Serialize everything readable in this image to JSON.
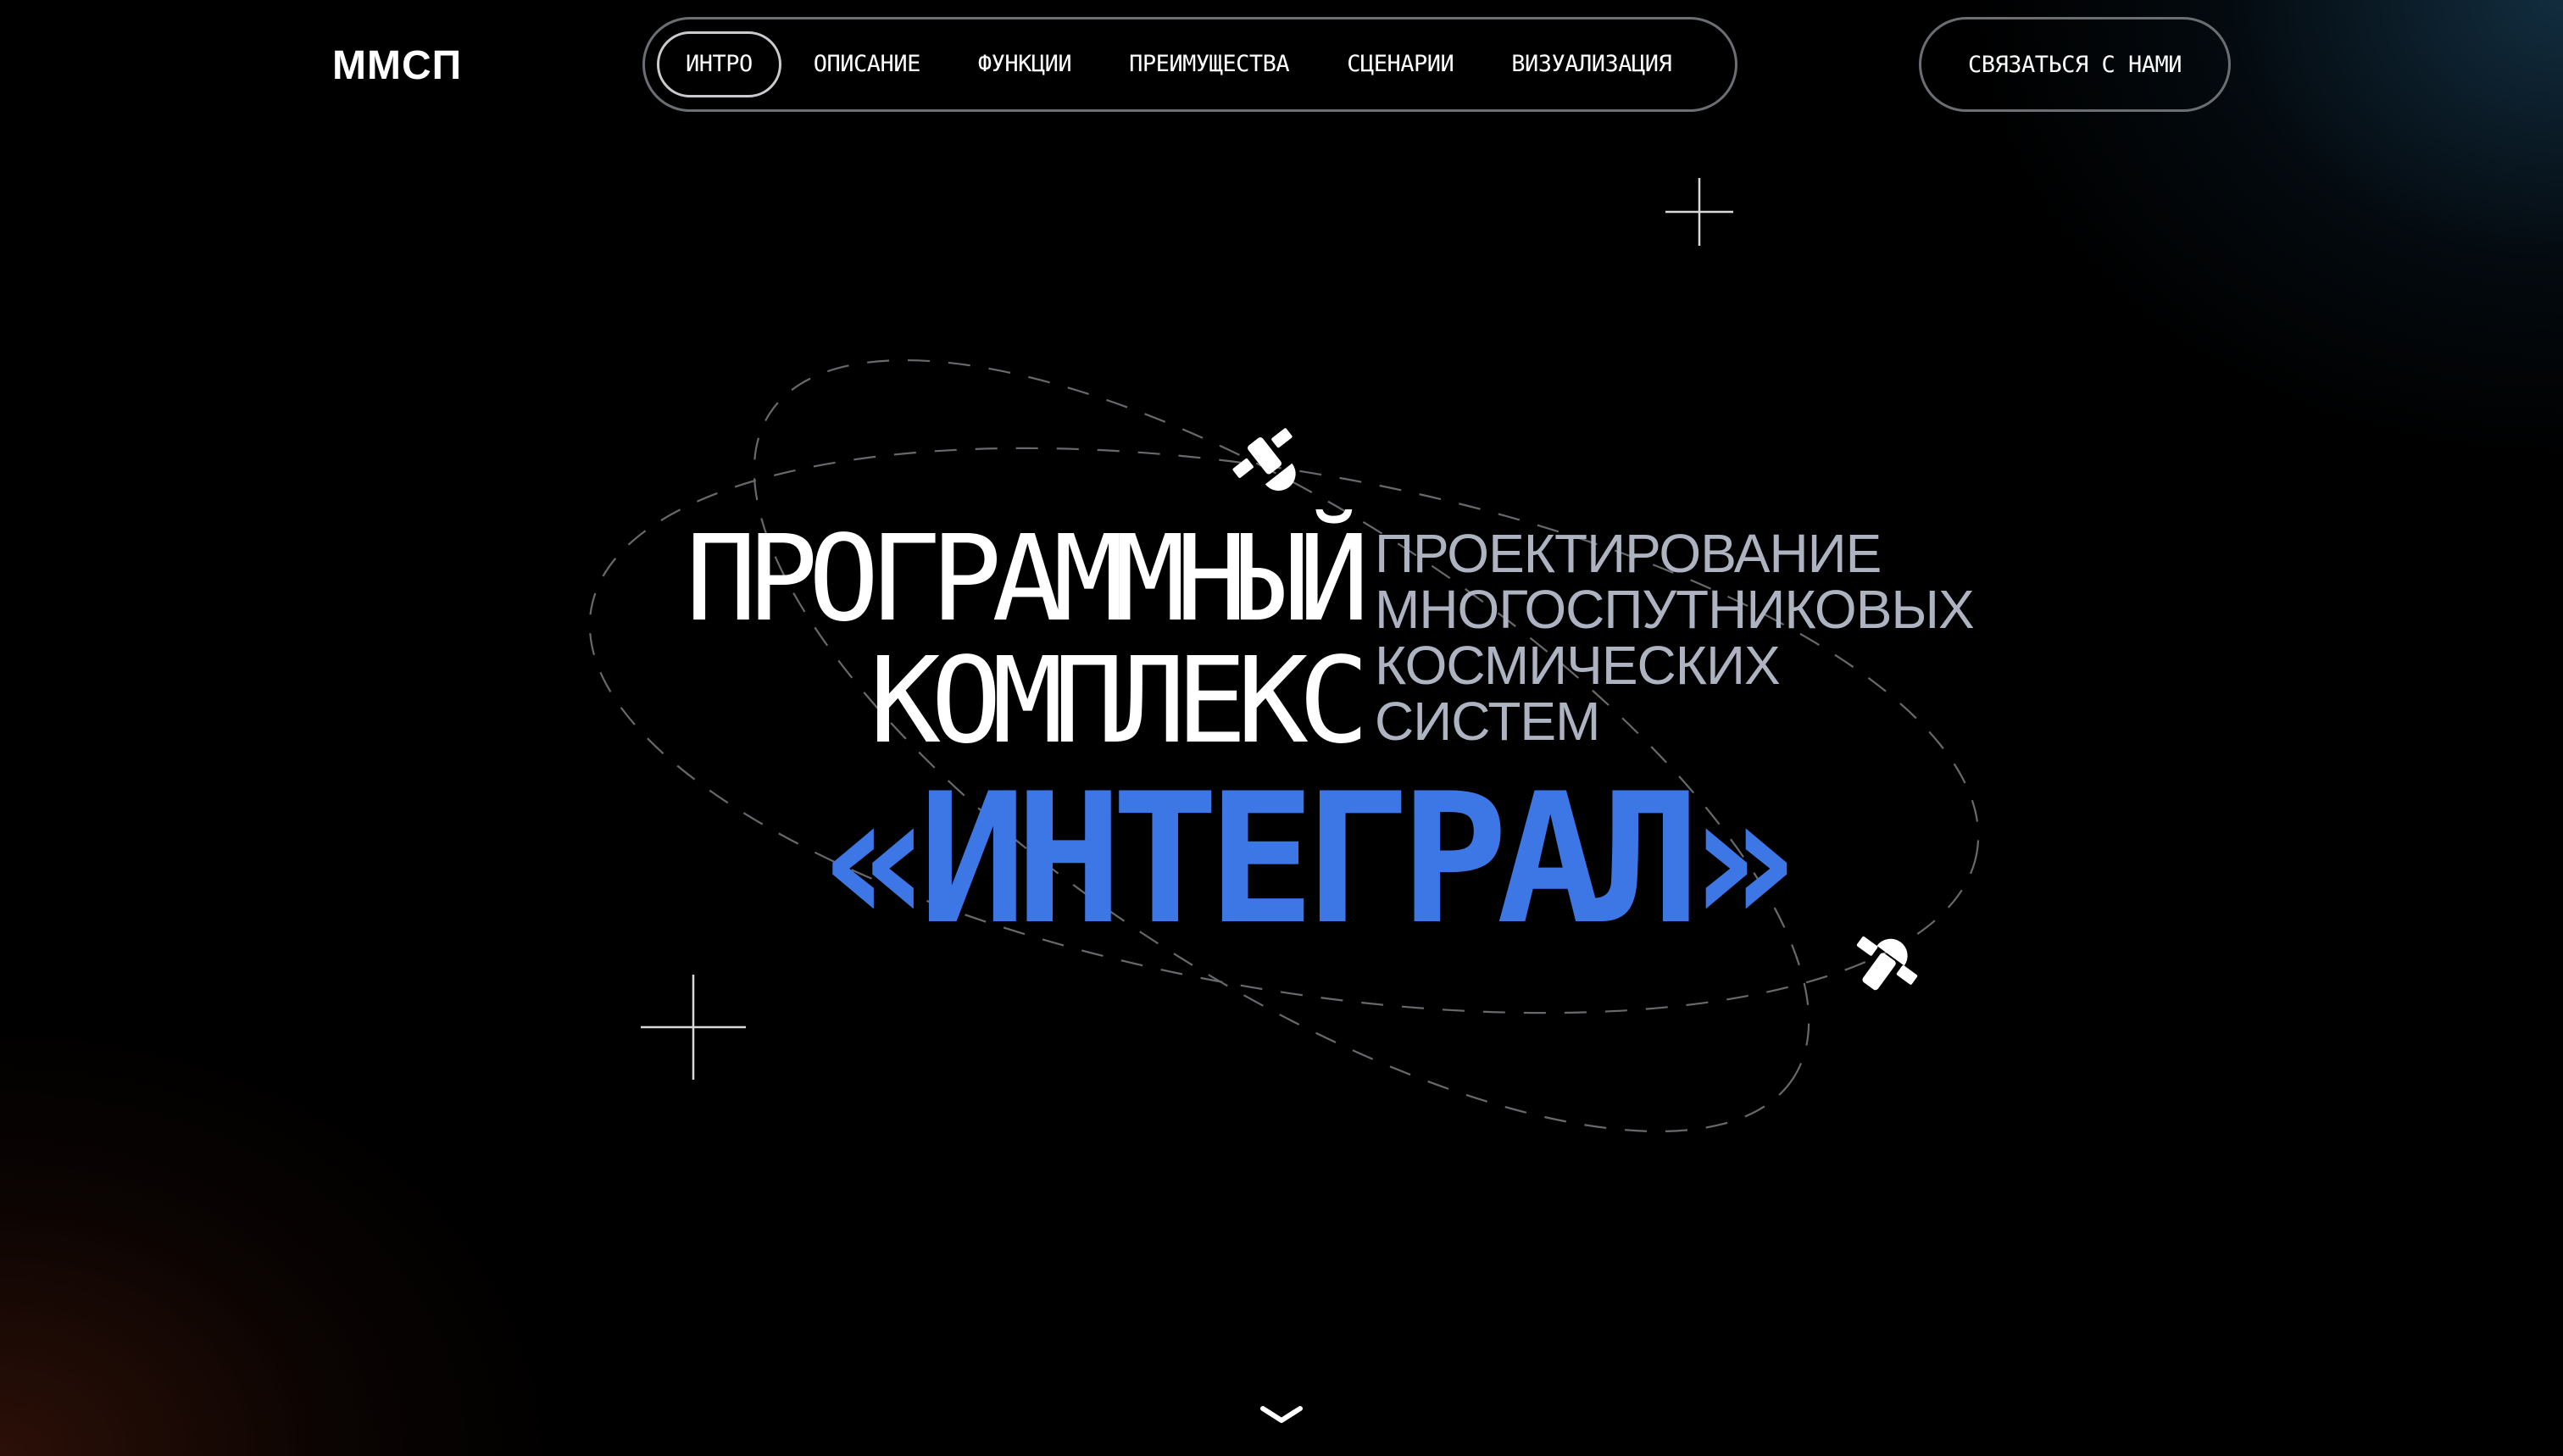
{
  "header": {
    "logo": "ММСП",
    "nav": [
      {
        "label": "ИНТРО",
        "active": true
      },
      {
        "label": "ОПИСАНИЕ",
        "active": false
      },
      {
        "label": "ФУНКЦИИ",
        "active": false
      },
      {
        "label": "ПРЕИМУЩЕСТВА",
        "active": false
      },
      {
        "label": "СЦЕНАРИИ",
        "active": false
      },
      {
        "label": "ВИЗУАЛИЗАЦИЯ",
        "active": false
      }
    ],
    "contact_label": "СВЯЗАТЬСЯ С НАМИ"
  },
  "hero": {
    "title_line1": "ПРОГРАММНЫЙ",
    "title_line2": "КОМПЛЕКС",
    "subtitle_lines": [
      "ПРОЕКТИРОВАНИЕ",
      "МНОГОСПУТНИКОВЫХ",
      "КОСМИЧЕСКИХ",
      "СИСТЕМ"
    ],
    "name": "«ИНТЕГРАЛ»"
  },
  "icons": {
    "satellite": "satellite-icon",
    "sparkle": "crosshair-sparkle-icon",
    "scroll": "chevron-down-icon"
  },
  "colors": {
    "accent": "#3d77e6",
    "subtitle": "#aeb3c2",
    "border": "#6b6f74"
  }
}
